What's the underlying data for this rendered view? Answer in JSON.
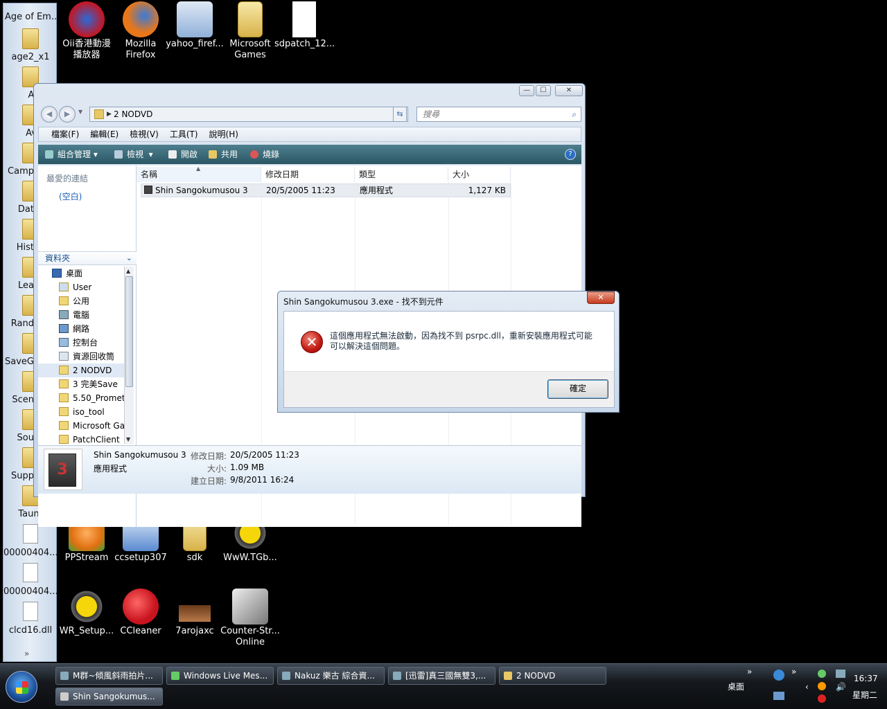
{
  "sidebar": {
    "title": "Age of Em...",
    "items": [
      {
        "label": "age2_x1",
        "type": "folder"
      },
      {
        "label": "Ai",
        "type": "folder"
      },
      {
        "label": "Av",
        "type": "folder"
      },
      {
        "label": "Camp",
        "type": "folder"
      },
      {
        "label": "Dat",
        "type": "folder"
      },
      {
        "label": "Hist",
        "type": "folder"
      },
      {
        "label": "Lea",
        "type": "folder"
      },
      {
        "label": "Rand",
        "type": "folder"
      },
      {
        "label": "SaveG",
        "type": "folder"
      },
      {
        "label": "Scen",
        "type": "folder"
      },
      {
        "label": "Sou",
        "type": "folder"
      },
      {
        "label": "Supp",
        "type": "folder"
      },
      {
        "label": "Taunt",
        "type": "folder"
      },
      {
        "label": "00000404...",
        "type": "file"
      },
      {
        "label": "00000404...",
        "type": "file"
      },
      {
        "label": "clcd16.dll",
        "type": "file"
      }
    ],
    "more": "»"
  },
  "desktop_top": [
    {
      "label": "Oii香港動漫 播放器",
      "icon": "player-icon",
      "color": "#c8141e"
    },
    {
      "label": "Mozilla Firefox",
      "icon": "firefox-icon",
      "color": "#e8771a"
    },
    {
      "label": "yahoo_firef...",
      "icon": "installer-icon",
      "color": "#8fb0d8"
    },
    {
      "label": "Microsoft Games",
      "icon": "folder-icon",
      "color": "#e7c864"
    },
    {
      "label": "sdpatch_12...",
      "icon": "document-icon",
      "color": "#ffffff"
    }
  ],
  "desktop_bottom": [
    {
      "label": "PPStream",
      "icon": "ppstream-icon",
      "color": "#3aa23a"
    },
    {
      "label": "ccsetup307",
      "icon": "installer-icon",
      "color": "#5a8ad0"
    },
    {
      "label": "sdk",
      "icon": "folder-icon",
      "color": "#e7c864"
    },
    {
      "label": "WwW.TGb...",
      "icon": "crosshair-icon",
      "color": "#f5d60a"
    },
    {
      "label": "WR_Setup...",
      "icon": "crosshair-icon",
      "color": "#f5d60a"
    },
    {
      "label": "CCleaner",
      "icon": "ccleaner-icon",
      "color": "#c8141e"
    },
    {
      "label": "7arojaxc",
      "icon": "image-icon",
      "color": "#8a4a2a"
    },
    {
      "label": "Counter-Str... Online",
      "icon": "counterstrike-icon",
      "color": "#dddddd"
    }
  ],
  "explorer": {
    "address": "2 NODVD",
    "search_placeholder": "搜尋",
    "window_buttons": {
      "minimize": "—",
      "maximize": "☐",
      "close": "✕"
    },
    "menu": [
      "檔案(F)",
      "編輯(E)",
      "檢視(V)",
      "工具(T)",
      "說明(H)"
    ],
    "toolbar": [
      "組合管理",
      "檢視",
      "開啟",
      "共用",
      "燒錄"
    ],
    "help": "?",
    "favorites_title": "最愛的連結",
    "favorites_empty": "(空白)",
    "folders_title": "資料夾",
    "tree": [
      {
        "label": "桌面",
        "indent": 1
      },
      {
        "label": "User",
        "indent": 2
      },
      {
        "label": "公用",
        "indent": 2
      },
      {
        "label": "電腦",
        "indent": 2
      },
      {
        "label": "網路",
        "indent": 2
      },
      {
        "label": "控制台",
        "indent": 2
      },
      {
        "label": "資源回收筒",
        "indent": 2
      },
      {
        "label": "2 NODVD",
        "indent": 2,
        "selected": true
      },
      {
        "label": "3 完美Save",
        "indent": 2
      },
      {
        "label": "5.50_Promet",
        "indent": 2
      },
      {
        "label": "iso_tool",
        "indent": 2
      },
      {
        "label": "Microsoft Ga",
        "indent": 2
      },
      {
        "label": "PatchClient",
        "indent": 2
      }
    ],
    "columns": [
      "名稱",
      "修改日期",
      "類型",
      "大小"
    ],
    "files": [
      {
        "name": "Shin Sangokumusou 3",
        "modified": "20/5/2005 11:23",
        "type": "應用程式",
        "size": "1,127 KB"
      }
    ],
    "details": {
      "name": "Shin Sangokumusou 3",
      "type": "應用程式",
      "modified_label": "修改日期:",
      "modified": "20/5/2005 11:23",
      "size_label": "大小:",
      "size": "1.09 MB",
      "created_label": "建立日期:",
      "created": "9/8/2011 16:24"
    }
  },
  "dialog": {
    "title": "Shin Sangokumusou 3.exe - 找不到元件",
    "close": "✕",
    "message": "這個應用程式無法啟動，因為找不到 psrpc.dll，重新安裝應用程式可能可以解決這個問題。",
    "ok": "確定"
  },
  "taskbar": {
    "buttons_row1": [
      "M群~傾風斜雨拍片...",
      "Windows Live Mes...",
      "Nakuz 樂古 綜合資...",
      "[迅雷]真三國無雙3,...",
      "2 NODVD"
    ],
    "buttons_row2": [
      "Shin Sangokumus..."
    ],
    "desktop_label": "桌面",
    "time": "16:37",
    "day": "星期二",
    "chevron": "»"
  }
}
